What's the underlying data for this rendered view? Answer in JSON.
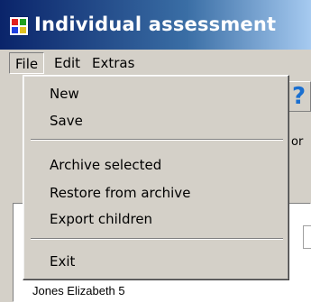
{
  "window": {
    "title": "Individual assessment"
  },
  "menubar": {
    "file": "File",
    "edit": "Edit",
    "extras": "Extras"
  },
  "file_menu": {
    "new": "New",
    "save": "Save",
    "archive_selected": "Archive selected",
    "restore_from_archive": "Restore from archive",
    "export_children": "Export children",
    "exit": "Exit"
  },
  "toolbar": {
    "help_glyph": "?"
  },
  "background": {
    "partial_label": "or"
  },
  "list": {
    "rows": [
      "Jones Elizabeth 5"
    ]
  }
}
